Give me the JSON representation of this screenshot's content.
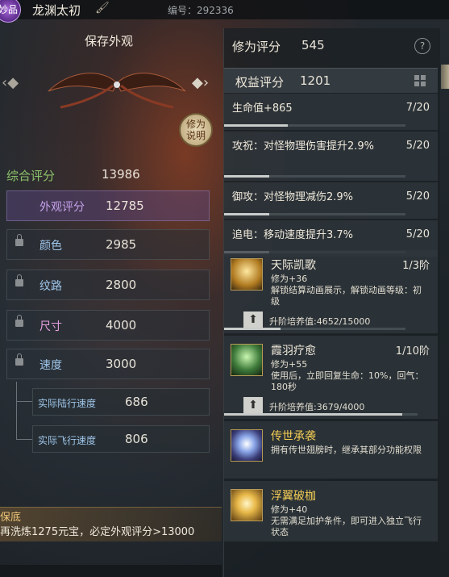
{
  "header": {
    "quality_badge": "妙品",
    "item_name": "龙渊太初",
    "code": "编号：292336"
  },
  "left": {
    "title": "保存外观",
    "explain_button": "修为\n说明",
    "overall_label": "综合评分",
    "overall_value": "13986",
    "rows": [
      {
        "label": "外观评分",
        "value": "12785"
      },
      {
        "label": "颜色",
        "value": "2985"
      },
      {
        "label": "纹路",
        "value": "2800"
      },
      {
        "label": "尺寸",
        "value": "4000"
      },
      {
        "label": "速度",
        "value": "3000"
      }
    ],
    "sub_rows": [
      {
        "label": "实际陆行速度",
        "value": "686"
      },
      {
        "label": "实际飞行速度",
        "value": "806"
      }
    ],
    "bottom_title": "保底",
    "bottom_text": "再洗炼1275元宝，必定外观评分>13000"
  },
  "right": {
    "cultivation_label": "修为评分",
    "cultivation_value": "545",
    "rights_label": "权益评分",
    "rights_value": "1201",
    "attributes": [
      {
        "text": "生命值+865",
        "progress": "7/20",
        "fraction": 0.35
      },
      {
        "text": "攻祝：对怪物理伤害提升2.9%",
        "progress": "5/20",
        "fraction": 0.25
      },
      {
        "text": "御攻：对怪物理减伤2.9%",
        "progress": "5/20",
        "fraction": 0.25
      },
      {
        "text": "追电：移动速度提升3.7%",
        "progress": "5/20",
        "fraction": 0.25
      }
    ],
    "skills": [
      {
        "name": "天际凯歌",
        "stage": "1/3阶",
        "desc": "修为+36\n解锁结算动画展示，解锁动画等级：初级",
        "upgrade": "升阶培养值:4652/15000",
        "fraction": 0.31
      },
      {
        "name": "霞羽疗愈",
        "stage": "1/10阶",
        "desc": "修为+55\n使用后，立即回复生命：10%，回气：180秒",
        "upgrade": "升阶培养值:3679/4000",
        "fraction": 0.92
      },
      {
        "name": "传世承袭",
        "desc": "拥有传世翅膀时，继承其部分功能权限"
      },
      {
        "name": "浮翼破枷",
        "desc": "修为+40\n无需满足加护条件，即可进入独立飞行状态"
      }
    ]
  }
}
